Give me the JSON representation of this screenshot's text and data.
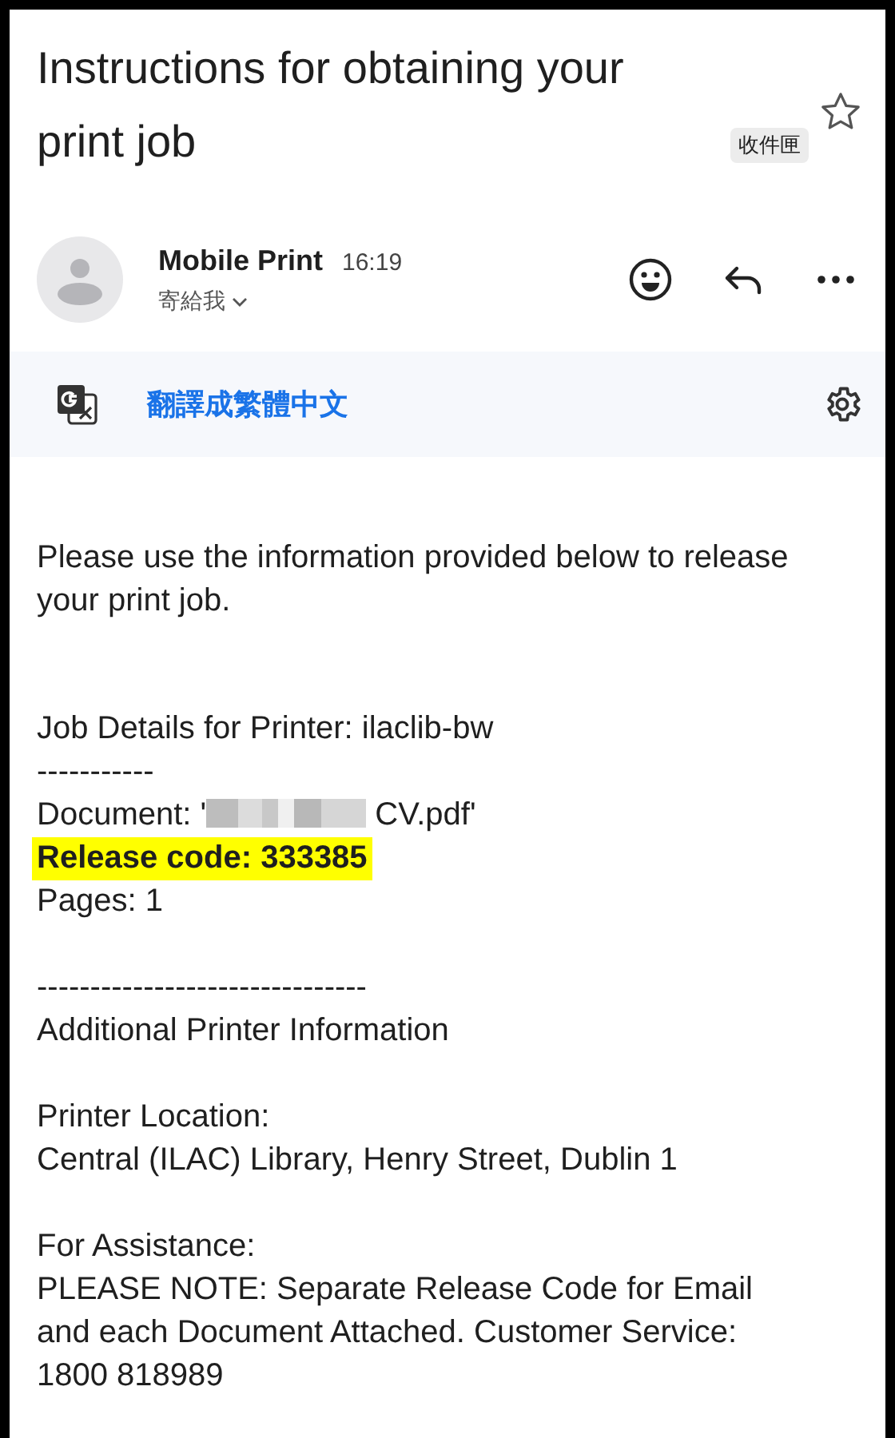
{
  "subject": {
    "title": "Instructions for obtaining your print job",
    "label": "收件匣",
    "starred": false
  },
  "sender": {
    "name": "Mobile Print",
    "time": "16:19",
    "recipient": "寄給我"
  },
  "translate_bar": {
    "link": "翻譯成繁體中文"
  },
  "body": [
    [
      {
        "kind": "text",
        "text": "Please use the information provided below to release your print job."
      }
    ],
    [
      {
        "kind": "text",
        "text": "Job Details for Printer: ilaclib-bw"
      },
      {
        "kind": "text",
        "text": "-----------"
      },
      {
        "kind": "redacted",
        "before": "Document: '",
        "after": "CV.pdf'"
      },
      {
        "kind": "highlight",
        "text": "Release code: 333385"
      },
      {
        "kind": "text",
        "text": "Pages: 1"
      }
    ],
    [
      {
        "kind": "text",
        "text": "-------------------------------"
      },
      {
        "kind": "text",
        "text": "Additional Printer Information"
      }
    ],
    [
      {
        "kind": "text",
        "text": "Printer Location:"
      },
      {
        "kind": "text",
        "text": "Central (ILAC) Library, Henry Street, Dublin 1"
      }
    ],
    [
      {
        "kind": "text",
        "text": "For Assistance:"
      },
      {
        "kind": "text",
        "text": "PLEASE NOTE: Separate Release Code for Email and each Document Attached. Customer Service: 1800 818989"
      }
    ]
  ]
}
